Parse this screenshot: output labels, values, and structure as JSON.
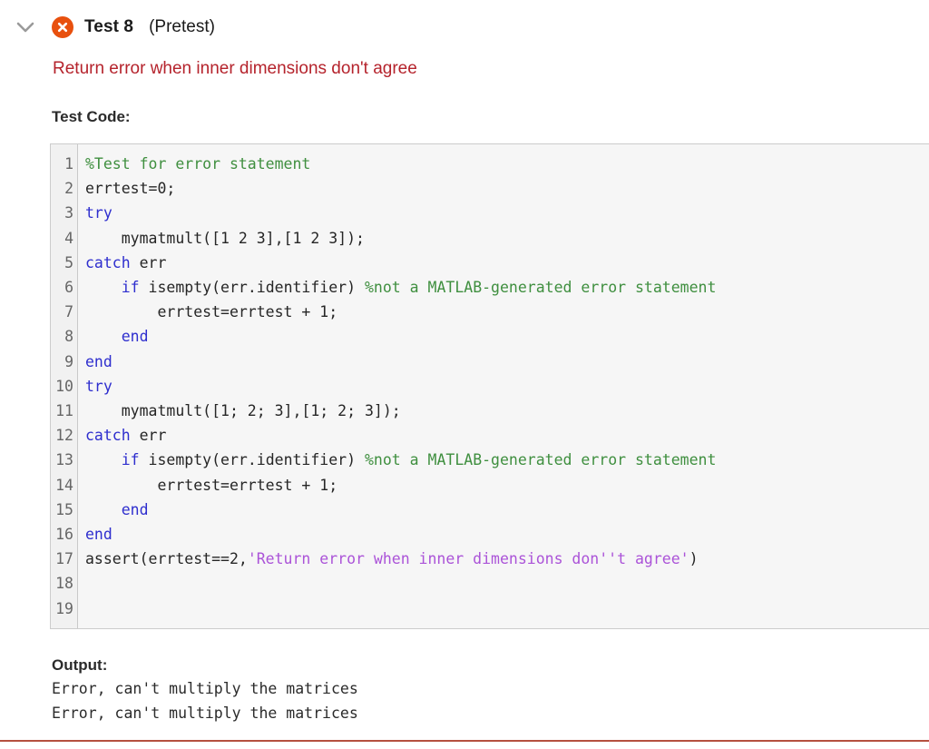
{
  "header": {
    "collapse_icon": "chevron-down-icon",
    "status_icon": "error-circle-x-icon",
    "status_color": "#e8500e",
    "title": "Test 8",
    "kind": "(Pretest)",
    "error_message": "Return error when inner dimensions don't agree",
    "error_color": "#b5232c"
  },
  "test_code": {
    "label": "Test Code:",
    "line_numbers": [
      "1",
      "2",
      "3",
      "4",
      "5",
      "6",
      "7",
      "8",
      "9",
      "10",
      "11",
      "12",
      "13",
      "14",
      "15",
      "16",
      "17",
      "18",
      "19"
    ],
    "lines": [
      [
        {
          "t": "%Test for error statement",
          "c": "comment"
        }
      ],
      [
        {
          "t": "errtest=0;",
          "c": "plain"
        }
      ],
      [
        {
          "t": "try",
          "c": "keyword"
        }
      ],
      [
        {
          "t": "    mymatmult([1 2 3],[1 2 3]);",
          "c": "plain"
        }
      ],
      [
        {
          "t": "catch",
          "c": "keyword"
        },
        {
          "t": " err",
          "c": "plain"
        }
      ],
      [
        {
          "t": "    ",
          "c": "plain"
        },
        {
          "t": "if",
          "c": "keyword"
        },
        {
          "t": " isempty(err.identifier) ",
          "c": "plain"
        },
        {
          "t": "%not a MATLAB-generated error statement",
          "c": "comment"
        }
      ],
      [
        {
          "t": "        errtest=errtest + 1;",
          "c": "plain"
        }
      ],
      [
        {
          "t": "    ",
          "c": "plain"
        },
        {
          "t": "end",
          "c": "keyword"
        }
      ],
      [
        {
          "t": "end",
          "c": "keyword"
        }
      ],
      [
        {
          "t": "try",
          "c": "keyword"
        }
      ],
      [
        {
          "t": "    mymatmult([1; 2; 3],[1; 2; 3]);",
          "c": "plain"
        }
      ],
      [
        {
          "t": "catch",
          "c": "keyword"
        },
        {
          "t": " err",
          "c": "plain"
        }
      ],
      [
        {
          "t": "    ",
          "c": "plain"
        },
        {
          "t": "if",
          "c": "keyword"
        },
        {
          "t": " isempty(err.identifier) ",
          "c": "plain"
        },
        {
          "t": "%not a MATLAB-generated error statement",
          "c": "comment"
        }
      ],
      [
        {
          "t": "        errtest=errtest + 1;",
          "c": "plain"
        }
      ],
      [
        {
          "t": "    ",
          "c": "plain"
        },
        {
          "t": "end",
          "c": "keyword"
        }
      ],
      [
        {
          "t": "end",
          "c": "keyword"
        }
      ],
      [
        {
          "t": "assert(errtest==2,",
          "c": "plain"
        },
        {
          "t": "'Return error when inner dimensions don''t agree'",
          "c": "string"
        },
        {
          "t": ")",
          "c": "plain"
        }
      ],
      [],
      []
    ],
    "colors": {
      "comment": "#3f8f3f",
      "keyword": "#2e2ece",
      "string": "#ab53d8",
      "plain": "#262626",
      "background": "#f6f6f6",
      "gutter_background": "#f1f1f1",
      "border": "#cccccc"
    }
  },
  "output": {
    "label": "Output:",
    "lines": [
      "Error, can't multiply the matrices",
      "Error, can't multiply the matrices"
    ]
  },
  "footer": {
    "rule_color": "#b5503f"
  }
}
